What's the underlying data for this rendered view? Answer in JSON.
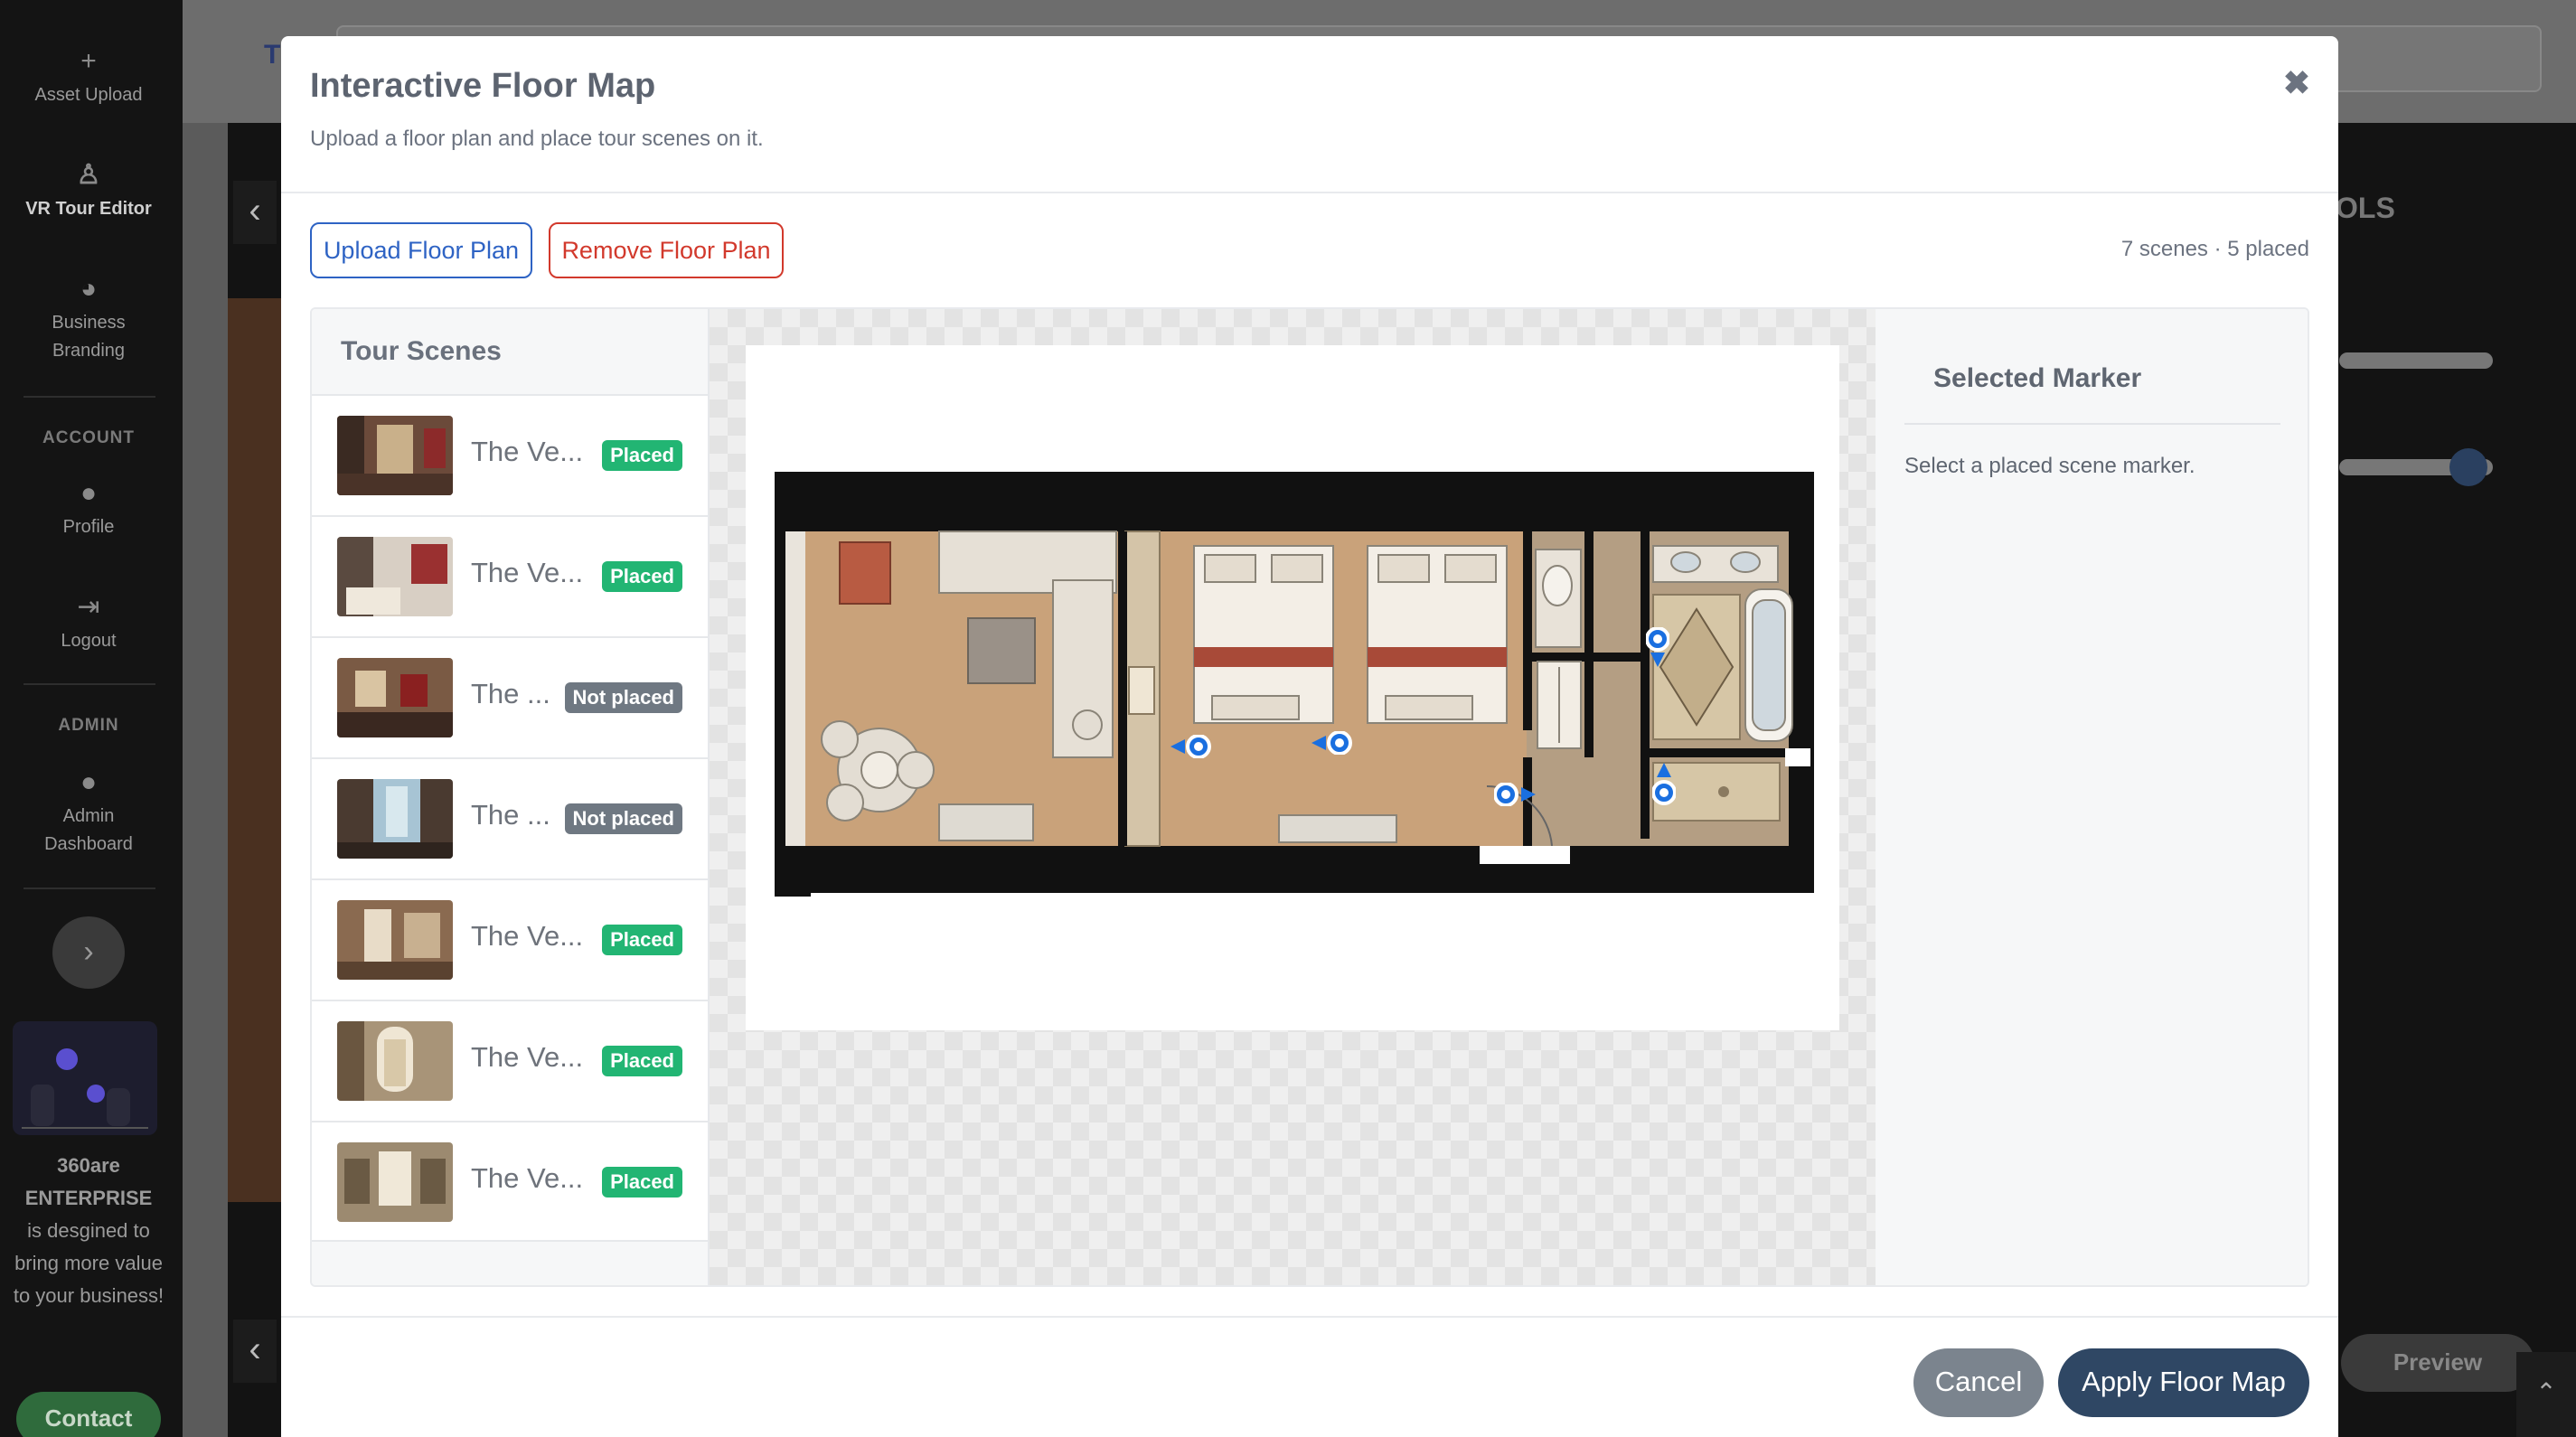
{
  "sidebar": {
    "items": [
      {
        "label": "Asset Upload",
        "icon": "plus-icon"
      },
      {
        "label": "VR Tour Editor",
        "icon": "person-vr-icon"
      },
      {
        "label": "Business Branding",
        "icon": "palette-icon"
      }
    ],
    "account_header": "ACCOUNT",
    "account_items": [
      {
        "label": "Profile",
        "icon": "user-icon"
      },
      {
        "label": "Logout",
        "icon": "logout-icon"
      }
    ],
    "admin_header": "ADMIN",
    "admin_items": [
      {
        "label": "Admin Dashboard",
        "icon": "user-icon"
      }
    ],
    "promo_brand": "360are ENTERPRISE",
    "promo_text": "is desgined to bring more value to your business!",
    "contact_label": "Contact"
  },
  "background": {
    "title_fragment": "T",
    "tools_fragment": "OLS",
    "preview_label": "Preview"
  },
  "modal": {
    "title": "Interactive Floor Map",
    "subtitle": "Upload a floor plan and place tour scenes on it.",
    "close_glyph": "✖",
    "upload_label": "Upload Floor Plan",
    "remove_label": "Remove Floor Plan",
    "scene_count": "7 scenes · 5 placed",
    "scenes_title": "Tour Scenes",
    "scenes": [
      {
        "name": "The Ve...",
        "status": "Placed",
        "placed": true
      },
      {
        "name": "The Ve...",
        "status": "Placed",
        "placed": true
      },
      {
        "name": "The ...",
        "status": "Not placed",
        "placed": false
      },
      {
        "name": "The ...",
        "status": "Not placed",
        "placed": false
      },
      {
        "name": "The Ve...",
        "status": "Placed",
        "placed": true
      },
      {
        "name": "The Ve...",
        "status": "Placed",
        "placed": true
      },
      {
        "name": "The Ve...",
        "status": "Placed",
        "placed": true
      }
    ],
    "selected_title": "Selected Marker",
    "selected_hint": "Select a placed scene marker.",
    "cancel_label": "Cancel",
    "apply_label": "Apply Floor Map"
  },
  "colors": {
    "primary": "#2e63c4",
    "danger": "#d2392c",
    "placed": "#22b573",
    "not_placed": "#6f7882",
    "marker": "#1a6fe0",
    "apply": "#2f4764"
  }
}
